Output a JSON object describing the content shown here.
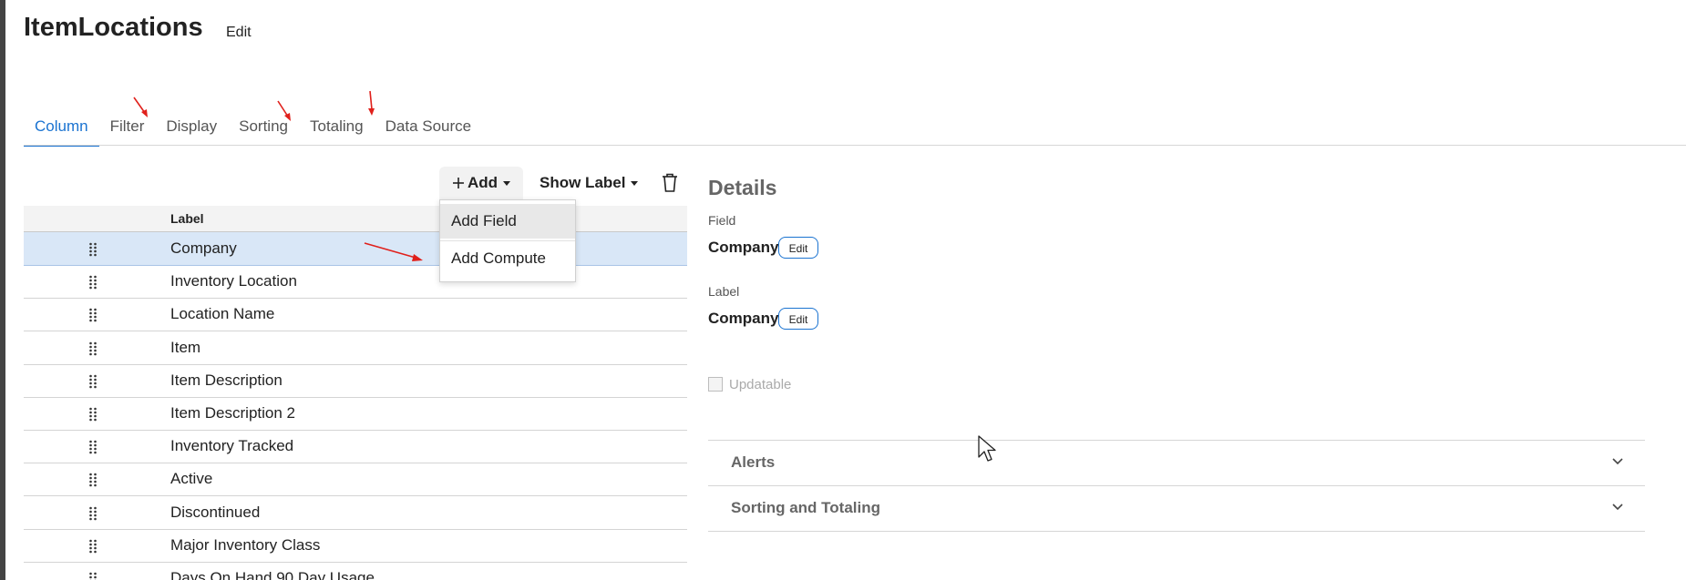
{
  "header": {
    "title": "ItemLocations",
    "edit_label": "Edit"
  },
  "tabs": [
    {
      "label": "Column",
      "active": true
    },
    {
      "label": "Filter",
      "active": false
    },
    {
      "label": "Display",
      "active": false
    },
    {
      "label": "Sorting",
      "active": false
    },
    {
      "label": "Totaling",
      "active": false
    },
    {
      "label": "Data Source",
      "active": false
    }
  ],
  "toolbar": {
    "add_label": "Add",
    "add_icon": "plus-icon",
    "show_label": "Show Label",
    "delete_icon": "trash-icon"
  },
  "add_menu": {
    "items": [
      "Add Field",
      "Add Compute"
    ],
    "hovered": "Add Field"
  },
  "grid": {
    "header_label": "Label",
    "rows": [
      {
        "label": "Company",
        "selected": true
      },
      {
        "label": "Inventory Location",
        "selected": false
      },
      {
        "label": "Location Name",
        "selected": false
      },
      {
        "label": "Item",
        "selected": false
      },
      {
        "label": "Item Description",
        "selected": false
      },
      {
        "label": "Item Description 2",
        "selected": false
      },
      {
        "label": "Inventory Tracked",
        "selected": false
      },
      {
        "label": "Active",
        "selected": false
      },
      {
        "label": "Discontinued",
        "selected": false
      },
      {
        "label": "Major Inventory Class",
        "selected": false
      },
      {
        "label": "Days On Hand 90 Day Usage",
        "selected": false
      }
    ]
  },
  "details": {
    "title": "Details",
    "field_caption": "Field",
    "field_value": "Company",
    "label_caption": "Label",
    "label_value": "Company",
    "edit_label": "Edit",
    "updatable_label": "Updatable",
    "updatable_checked": false,
    "sections": [
      {
        "label": "Alerts",
        "expanded": false
      },
      {
        "label": "Sorting and Totaling",
        "expanded": false
      }
    ]
  },
  "colors": {
    "accent": "#1a73d1",
    "selected_row": "#d9e7f7",
    "annotation_arrow": "#e0201b"
  }
}
